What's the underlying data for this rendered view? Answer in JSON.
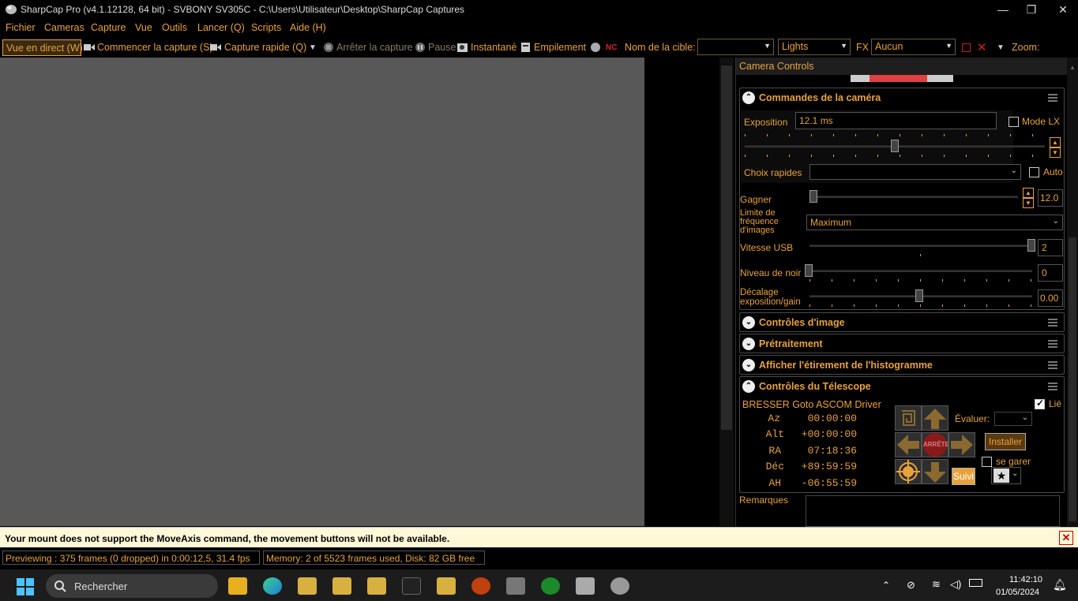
{
  "window": {
    "title": "SharpCap Pro (v4.1.12128, 64 bit) - SVBONY SV305C - C:\\Users\\Utilisateur\\Desktop\\SharpCap Captures"
  },
  "menu": [
    "Fichier",
    "Cameras",
    "Capture",
    "Vue",
    "Outils",
    "Lancer (Q)",
    "Scripts",
    "Aide (H)"
  ],
  "toolbar": {
    "live_view": "Vue en direct (W)",
    "start_capture": "Commencer la capture (S)",
    "quick_capture": "Capture rapide (Q)",
    "stop_capture": "Arrêter la capture",
    "pause": "Pause",
    "snapshot": "Instantané",
    "stacking": "Empilement",
    "target_label": "Nom de la cible:",
    "target_value": "",
    "frame_type": "Lights",
    "fx_label": "FX",
    "fx_value": "Aucun",
    "zoom_label": "Zoom:"
  },
  "panel": {
    "title": "Camera Controls",
    "camera": {
      "heading": "Commandes de la caméra",
      "exposure_label": "Exposition",
      "exposure_value": "12.1 ms",
      "lx_label": "Mode LX",
      "quick_choices_label": "Choix rapides",
      "auto_label": "Auto",
      "gain_label": "Gagner",
      "gain_value": "12.0",
      "frame_rate_label_1": "Limite de",
      "frame_rate_label_2": "fréquence",
      "frame_rate_label_3": "d'images",
      "frame_rate_value": "Maximum",
      "usb_label": "Vitesse USB",
      "usb_value": "2",
      "black_label": "Niveau de noir",
      "black_value": "0",
      "offset_label_1": "Décalage",
      "offset_label_2": "exposition/gain",
      "offset_value": "0.00"
    },
    "sections": [
      "Contrôles d'image",
      "Prétraitement",
      "Afficher l'étirement de l'histogramme"
    ],
    "telescope": {
      "heading": "Contrôles du Télescope",
      "driver": "BRESSER Goto ASCOM Driver",
      "linked_label": "Lié",
      "coords": [
        {
          "k": "Az",
          "v": "00:00:00"
        },
        {
          "k": "Alt",
          "v": "+00:00:00"
        },
        {
          "k": "RA",
          "v": "07:18:36"
        },
        {
          "k": "Déc",
          "v": "+89:59:59"
        },
        {
          "k": "AH",
          "v": "-06:55:59"
        }
      ],
      "stop_label": "ARRÊTE",
      "rate_label": "Évaluer:",
      "install_label": "Installer",
      "park_label": "se garer",
      "track_label": "Suivi",
      "remarks_label": "Remarques"
    }
  },
  "notification": "Your mount does not support the MoveAxis command, the movement buttons will not be available.",
  "status": {
    "preview": "Previewing : 375 frames (0 dropped) in 0:00:12,5, 31.4 fps",
    "memory": "Memory: 2 of 5523 frames used, Disk: 82 GB free"
  },
  "taskbar": {
    "search": "Rechercher",
    "time": "11:42:10",
    "date": "01/05/2024"
  },
  "colors": {
    "accent": "#e8a23c",
    "viewer": "#585858",
    "notify_bg": "#fff8d8"
  }
}
